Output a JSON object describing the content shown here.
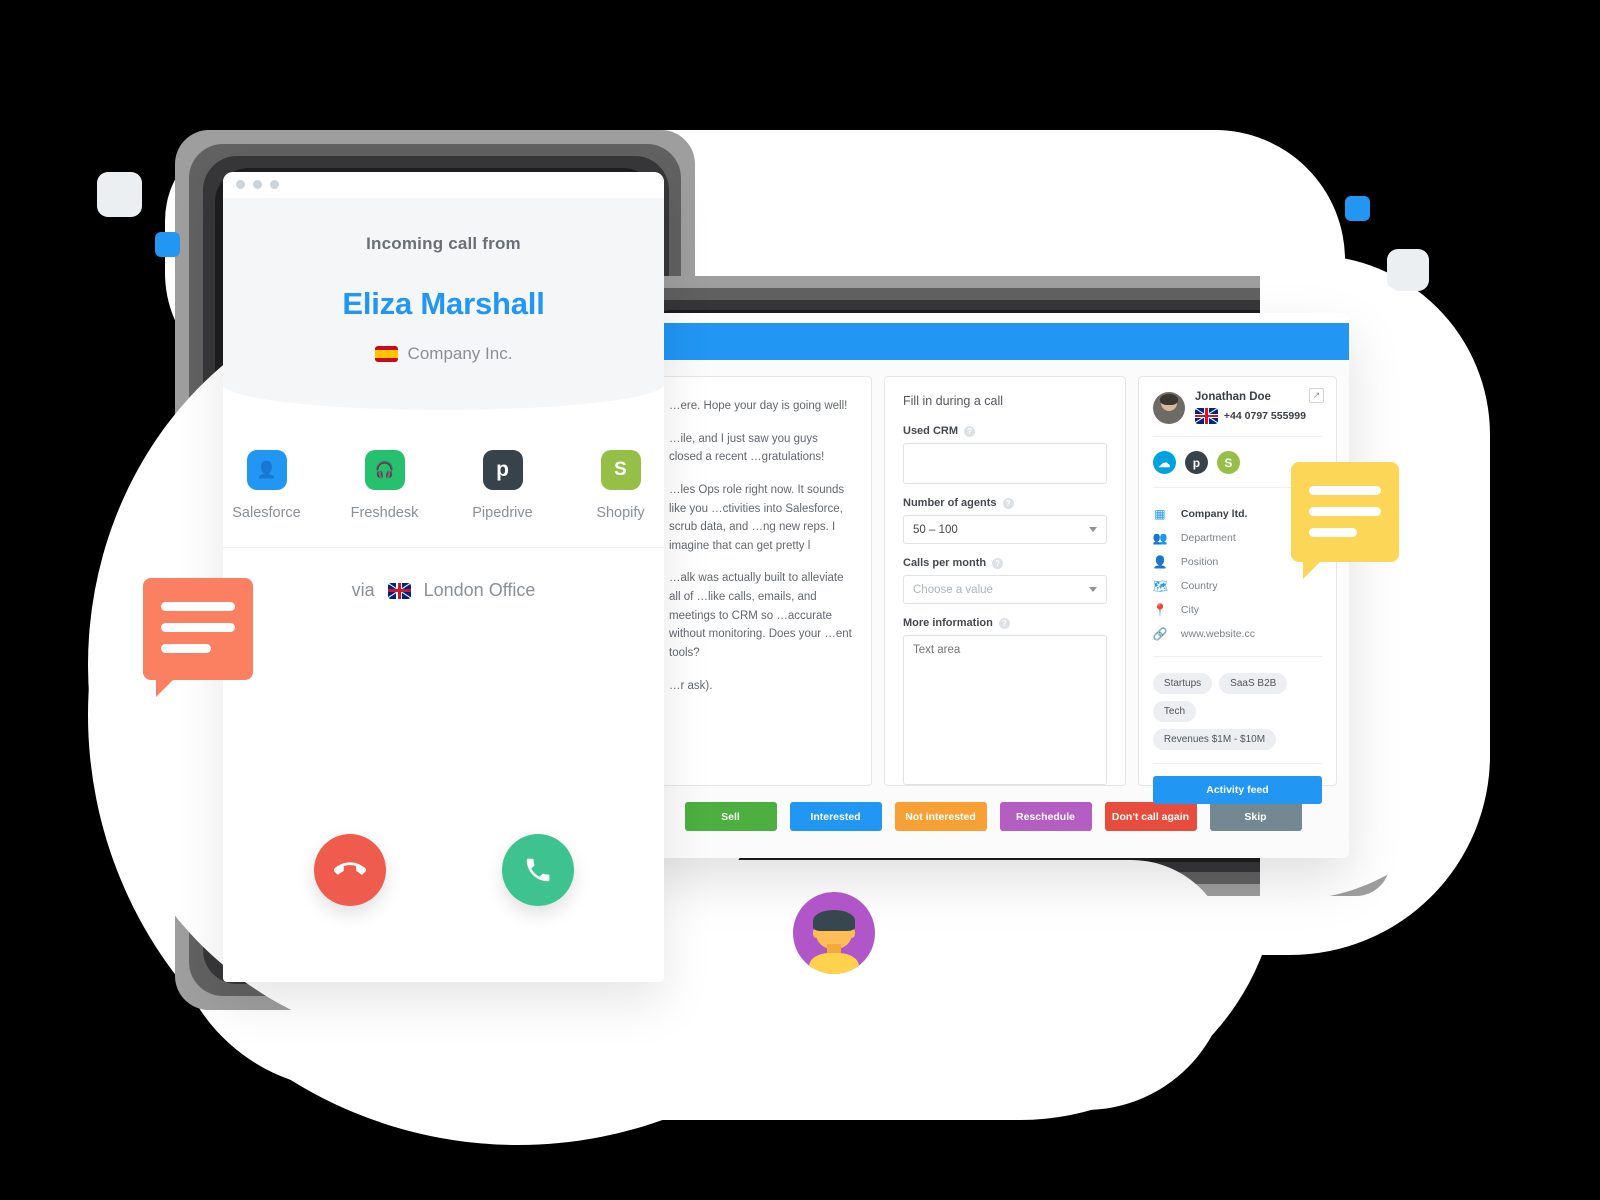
{
  "phone_window": {
    "incoming_label": "Incoming call from",
    "caller_name": "Eliza Marshall",
    "company": "Company Inc.",
    "company_flag": "flag-spain-icon",
    "integrations": [
      {
        "label": "Salesforce",
        "icon": "salesforce-icon",
        "color": "#2196f3",
        "glyph": "●"
      },
      {
        "label": "Freshdesk",
        "icon": "freshdesk-icon",
        "color": "#25c16f",
        "glyph": "●"
      },
      {
        "label": "Pipedrive",
        "icon": "pipedrive-icon",
        "color": "#37424a",
        "glyph": "p"
      },
      {
        "label": "Shopify",
        "icon": "shopify-icon",
        "color": "#95bf47",
        "glyph": "S"
      }
    ],
    "via_prefix": "via",
    "via_flag": "flag-uk-icon",
    "via_office": "London Office",
    "decline_button": "decline-call",
    "accept_button": "accept-call"
  },
  "browser_window": {
    "script_paragraphs": [
      "…ere. Hope your day is going well!",
      "…ile, and I just saw you guys closed a recent …gratulations!",
      "…les Ops role right now. It sounds like you …ctivities into Salesforce, scrub data, and …ng new reps. I imagine that can get pretty l",
      "…alk was actually built to alleviate all of …like calls, emails, and meetings to CRM so …accurate without monitoring. Does your …ent tools?",
      "…r ask)."
    ],
    "form": {
      "title": "Fill in during a call",
      "fields": [
        {
          "label": "Used CRM",
          "type": "text",
          "value": "",
          "placeholder": ""
        },
        {
          "label": "Number of agents",
          "type": "select",
          "value": "50 – 100",
          "placeholder": ""
        },
        {
          "label": "Calls per month",
          "type": "select",
          "value": "",
          "placeholder": "Choose a value"
        },
        {
          "label": "More information",
          "type": "textarea",
          "value": "",
          "placeholder": "Text area"
        }
      ],
      "help_glyph": "?"
    },
    "contact": {
      "name": "Jonathan Doe",
      "phone": "+44 0797 555999",
      "phone_flag": "flag-uk-icon",
      "expand_icon": "external-link-icon",
      "crm_badges": [
        {
          "name": "salesforce-badge",
          "color": "#00a1e0",
          "glyph": "☁"
        },
        {
          "name": "pipedrive-badge",
          "color": "#37424a",
          "glyph": "p"
        },
        {
          "name": "shopify-badge",
          "color": "#95bf47",
          "glyph": "S"
        }
      ],
      "info_rows": [
        {
          "icon": "building-icon",
          "glyph": "Ἶ2",
          "text": "Company ltd.",
          "strong": true
        },
        {
          "icon": "people-icon",
          "glyph": "●",
          "text": "Department",
          "strong": false
        },
        {
          "icon": "person-icon",
          "glyph": "●",
          "text": "Position",
          "strong": false
        },
        {
          "icon": "map-icon",
          "glyph": "■",
          "text": "Country",
          "strong": false
        },
        {
          "icon": "pin-icon",
          "glyph": "●",
          "text": "City",
          "strong": false
        },
        {
          "icon": "link-icon",
          "glyph": "⚭",
          "text": "www.website.cc",
          "strong": false
        }
      ],
      "tags": [
        "Startups",
        "SaaS B2B",
        "Tech",
        "Revenues $1M - $10M"
      ],
      "activity_button": "Activity feed"
    },
    "outcomes": [
      {
        "label": "Sell",
        "color": "#4caf3f"
      },
      {
        "label": "Interested",
        "color": "#2196f3"
      },
      {
        "label": "Not interested",
        "color": "#f6a036"
      },
      {
        "label": "Reschedule",
        "color": "#b45ec4"
      },
      {
        "label": "Don't call again",
        "color": "#e74c3c"
      },
      {
        "label": "Skip",
        "color": "#748891"
      }
    ],
    "accent_color": "#2196f3"
  },
  "decor": {
    "bubble_orange_color": "#fb8062",
    "bubble_yellow_color": "#fcd757",
    "avatar_bg_color": "#b056c9",
    "square_light_color": "#eceff1",
    "square_blue_color": "#2196f3"
  }
}
